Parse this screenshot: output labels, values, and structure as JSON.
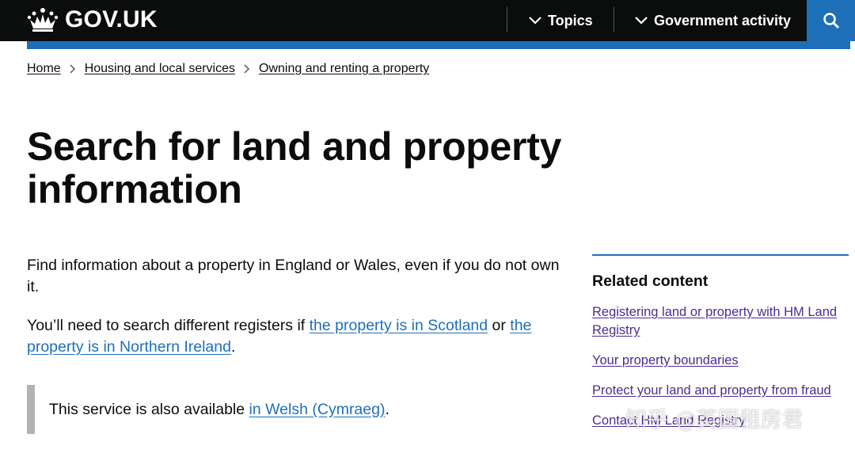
{
  "header": {
    "logo_text": "GOV.UK",
    "nav": [
      {
        "label": "Topics"
      },
      {
        "label": "Government activity"
      }
    ]
  },
  "breadcrumbs": [
    "Home",
    "Housing and local services",
    "Owning and renting a property"
  ],
  "page": {
    "title": "Search for land and property information",
    "para1": "Find information about a property in England or Wales, even if you do not own it.",
    "para2_prefix": "You’ll need to search different registers if ",
    "para2_link1": "the property is in Scotland",
    "para2_mid": " or ",
    "para2_link2": "the property is in Northern Ireland",
    "para2_suffix": ".",
    "inset_prefix": "This service is also available ",
    "inset_link": "in Welsh (Cymraeg)",
    "inset_suffix": "."
  },
  "related": {
    "heading": "Related content",
    "links": [
      "Registering land or property with HM Land Registry",
      "Your property boundaries",
      "Protect your land and property from fraud",
      "Contact HM Land Registry"
    ]
  },
  "watermark": "知乎 @英国租房君",
  "colors": {
    "header_bg": "#0b0c0c",
    "brand_blue": "#1d70b8",
    "visited_link": "#4c2c92",
    "inset_border": "#b1b4b6"
  }
}
